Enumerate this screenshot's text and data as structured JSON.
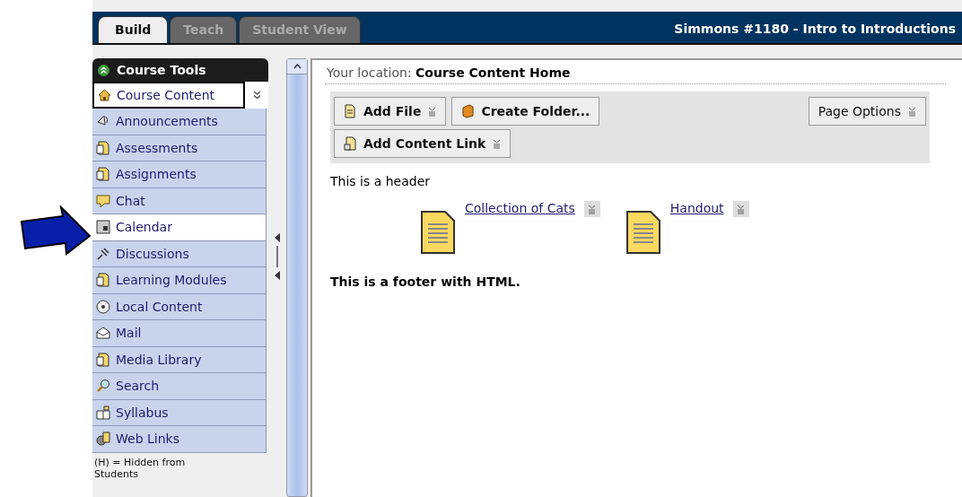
{
  "tabs": [
    {
      "label": "Build",
      "selected": true
    },
    {
      "label": "Teach",
      "selected": false
    },
    {
      "label": "Student View",
      "selected": false
    }
  ],
  "course_title": "Simmons #1180 - Intro to Introductions",
  "sidebar": {
    "title": "Course Tools",
    "current": "Course Content",
    "items": [
      {
        "label": "Announcements",
        "selected": false
      },
      {
        "label": "Assessments",
        "selected": false
      },
      {
        "label": "Assignments",
        "selected": false
      },
      {
        "label": "Chat",
        "selected": false
      },
      {
        "label": "Calendar",
        "selected": true
      },
      {
        "label": "Discussions",
        "selected": false
      },
      {
        "label": "Learning Modules",
        "selected": false
      },
      {
        "label": "Local Content",
        "selected": false
      },
      {
        "label": "Mail",
        "selected": false
      },
      {
        "label": "Media Library",
        "selected": false
      },
      {
        "label": "Search",
        "selected": false
      },
      {
        "label": "Syllabus",
        "selected": false
      },
      {
        "label": "Web Links",
        "selected": false
      }
    ],
    "note": "(H) = Hidden from Students"
  },
  "location": {
    "label": "Your location:",
    "value": "Course Content Home"
  },
  "toolbar": {
    "buttons": [
      {
        "label": "Add File",
        "menu": true
      },
      {
        "label": "Create Folder...",
        "menu": false
      },
      {
        "label": "Add Content Link",
        "menu": true
      }
    ],
    "page_options": "Page Options"
  },
  "header_text": "This is a header",
  "items": [
    {
      "label": "Collection of Cats"
    },
    {
      "label": "Handout"
    }
  ],
  "footer_text": "This is a footer with HTML."
}
